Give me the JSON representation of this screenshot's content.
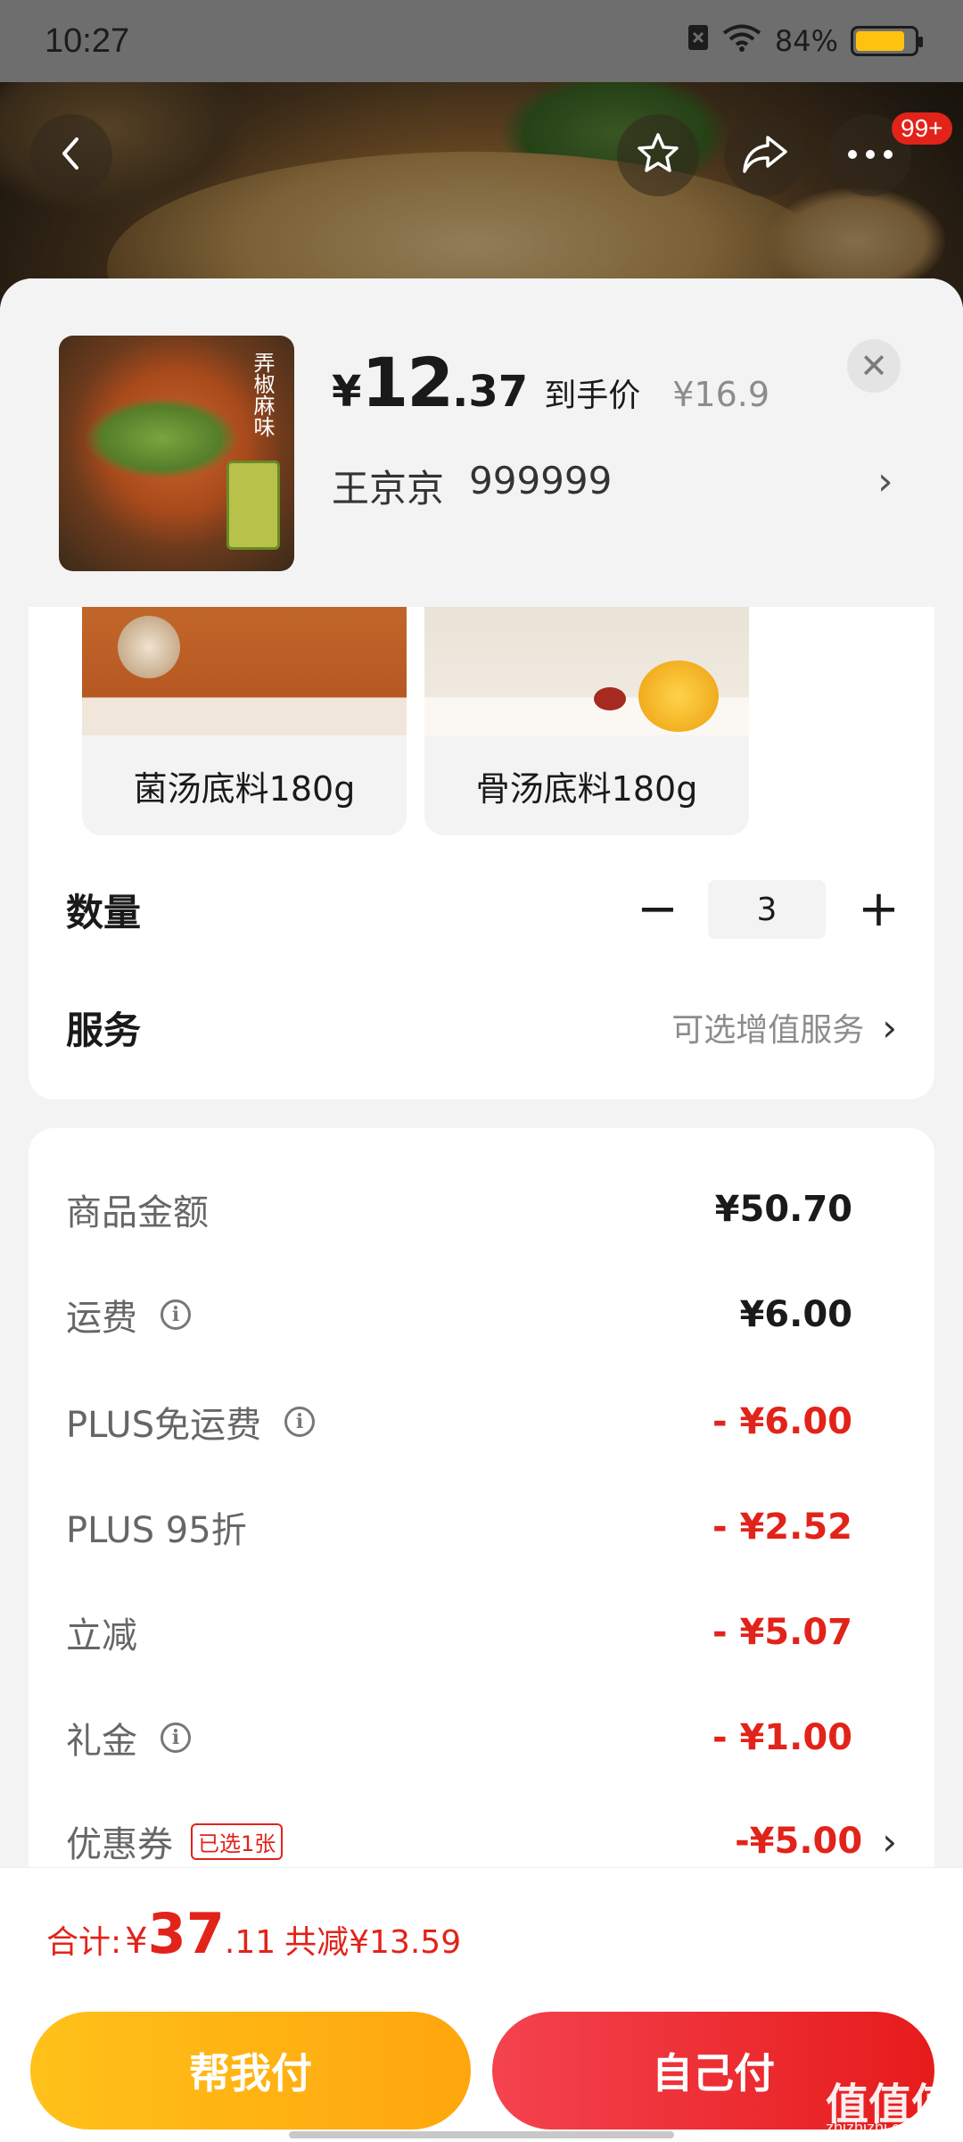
{
  "status_bar": {
    "time": "10:27",
    "battery": "84%",
    "battery_level": 0.84
  },
  "nav": {
    "badge": "99+"
  },
  "product": {
    "price_symbol": "¥",
    "price_int": "12",
    "price_dec": ".37",
    "price_label": "到手价",
    "original_price": "¥16.9",
    "addr_name": "王京京",
    "addr_num": "999999",
    "thumb_text": "弄椒麻味"
  },
  "options": [
    {
      "label": "菌汤底料180g"
    },
    {
      "label": "骨汤底料180g"
    }
  ],
  "quantity": {
    "label": "数量",
    "minus": "−",
    "value": "3",
    "plus": "+"
  },
  "service": {
    "label": "服务",
    "value": "可选增值服务"
  },
  "costs": [
    {
      "label": "商品金额",
      "value": "¥50.70",
      "red": false,
      "info": false
    },
    {
      "label": "运费",
      "value": "¥6.00",
      "red": false,
      "info": true
    },
    {
      "label": "PLUS免运费",
      "value": "- ¥6.00",
      "red": true,
      "info": true
    },
    {
      "label": "PLUS 95折",
      "value": "- ¥2.52",
      "red": true,
      "info": false
    },
    {
      "label": "立减",
      "value": "- ¥5.07",
      "red": true,
      "info": false
    },
    {
      "label": "礼金",
      "value": "- ¥1.00",
      "red": true,
      "info": true
    }
  ],
  "coupon": {
    "label": "优惠券",
    "tag": "已选1张",
    "value": "-¥5.00"
  },
  "footer": {
    "total_label": "合计:",
    "total_symbol": "¥",
    "total_int": "37",
    "total_dec": ".11",
    "save_text": "共减¥13.59",
    "pay_friend": "帮我付",
    "pay_self": "自己付"
  },
  "watermark": {
    "main": "值值值",
    "sub": "zhizhizhi.com"
  },
  "colors": {
    "accent_red": "#e2231a",
    "friend_button": "#ffb314",
    "self_button": "#ec2a2f"
  }
}
